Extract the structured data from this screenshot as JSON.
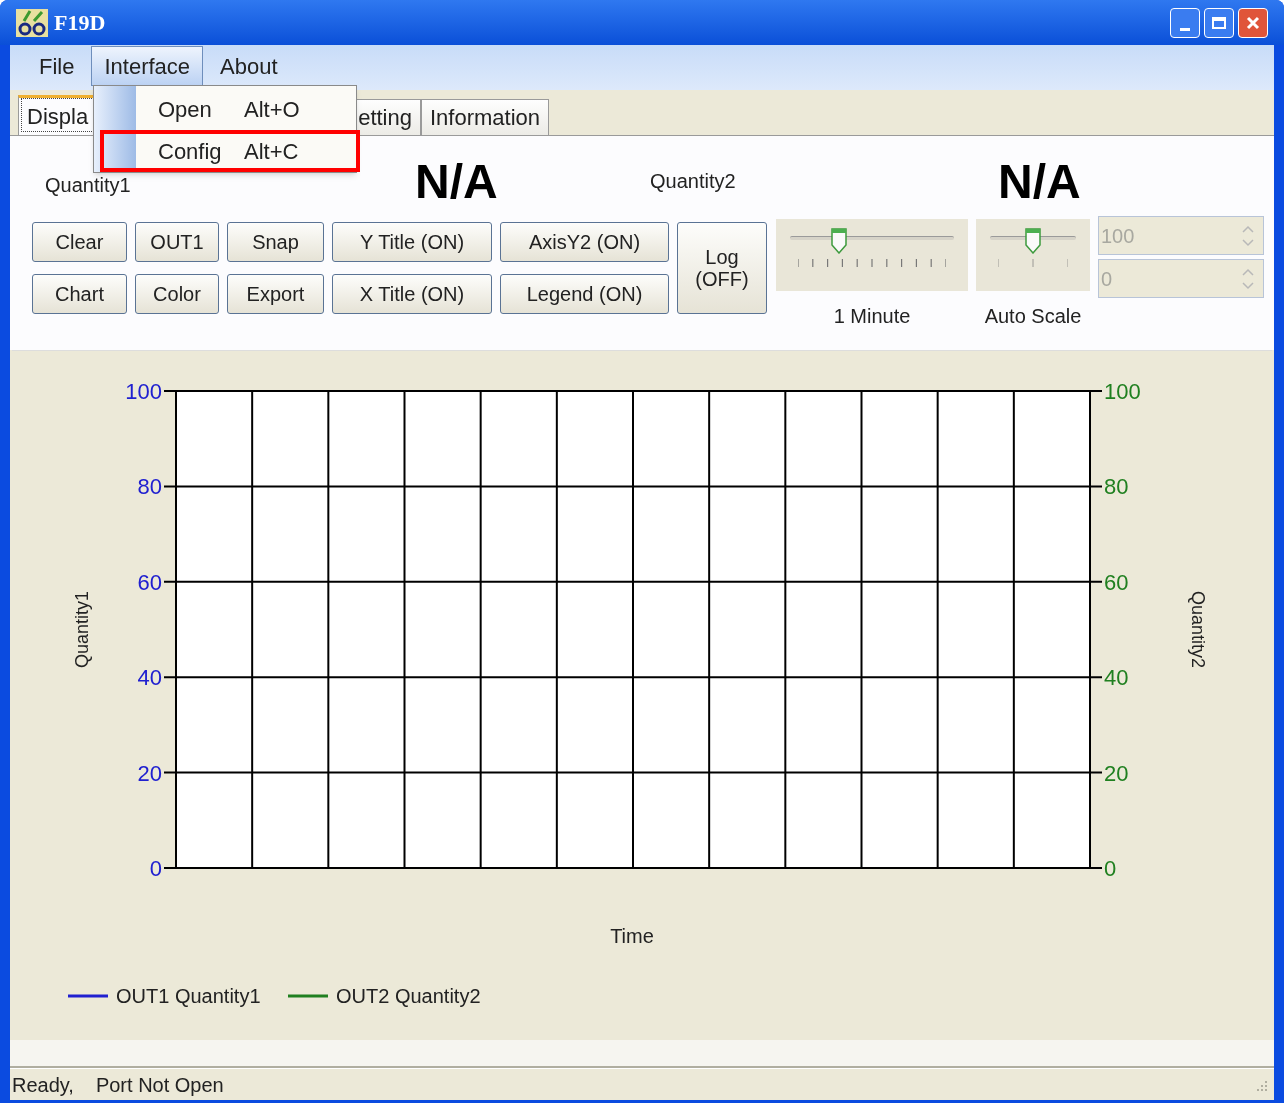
{
  "window": {
    "title": "F19D"
  },
  "menu_bar": [
    {
      "label": "File",
      "selected": false
    },
    {
      "label": "Interface",
      "selected": true
    },
    {
      "label": "About",
      "selected": false
    }
  ],
  "dropdown": [
    {
      "label": "Open",
      "shortcut": "Alt+O",
      "highlighted": false
    },
    {
      "label": "Config",
      "shortcut": "Alt+C",
      "highlighted": true
    }
  ],
  "tabs": [
    {
      "label": "Displa",
      "selected": true
    },
    {
      "label": "etting",
      "selected": false
    },
    {
      "label": "Information",
      "selected": false
    }
  ],
  "readouts": [
    {
      "label": "Quantity1",
      "value": "N/A"
    },
    {
      "label": "Quantity2",
      "value": "N/A"
    }
  ],
  "button_rows": [
    [
      "Clear",
      "OUT1",
      "Snap",
      "Y Title (ON)",
      "AxisY2 (ON)"
    ],
    [
      "Chart",
      "Color",
      "Export",
      "X Title (ON)",
      "Legend (ON)"
    ]
  ],
  "log_button": "Log (OFF)",
  "sliders": [
    {
      "caption": "1 Minute",
      "level": 0.3
    },
    {
      "caption": "Auto Scale",
      "level": 0.5
    }
  ],
  "spinners": [
    {
      "value": "100",
      "disabled": true
    },
    {
      "value": "0",
      "disabled": true
    }
  ],
  "chart": {
    "chart_data": {
      "type": "line",
      "grid": true,
      "xlabel": "Time",
      "ylabel": "Quantity1",
      "ylim": [
        0,
        100
      ],
      "yticks": [
        0,
        20,
        40,
        60,
        80,
        100
      ],
      "series": [
        {
          "name": "OUT1 Quantity1",
          "color": "#2020d0"
        },
        {
          "name": "OUT2 Quantity2",
          "color": "#208020"
        }
      ]
    },
    "right_axis": {
      "title": "Quantity2",
      "ticks": [
        "100",
        "80",
        "60",
        "40",
        "20",
        "0"
      ]
    }
  },
  "status_bar": [
    "Ready,",
    "Port Not Open"
  ]
}
